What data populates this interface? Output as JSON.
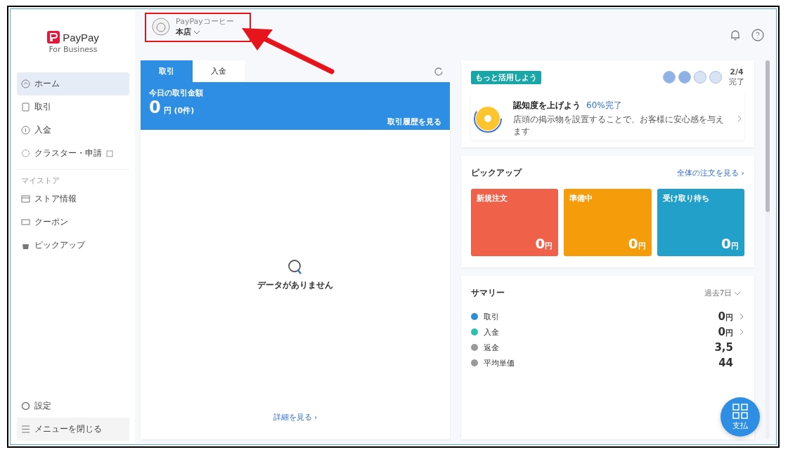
{
  "logo": {
    "name": "PayPay",
    "subtitle": "For Business"
  },
  "store": {
    "company": "PayPayコーヒー",
    "name": "本店"
  },
  "sidebar": {
    "items": [
      {
        "label": "ホーム",
        "selected": true,
        "external": false
      },
      {
        "label": "取引",
        "selected": false,
        "external": false
      },
      {
        "label": "入金",
        "selected": false,
        "external": false
      },
      {
        "label": "クラスター・申請",
        "selected": false,
        "external": true
      }
    ],
    "section": "マイストア",
    "store_items": [
      {
        "label": "ストア情報",
        "selected": false
      },
      {
        "label": "クーポン",
        "selected": false
      },
      {
        "label": "ピックアップ",
        "selected": false
      }
    ],
    "settings": "設定",
    "collapse": "メニューを閉じる"
  },
  "transactions": {
    "tabs": [
      {
        "label": "取引",
        "selected": true
      },
      {
        "label": "入金",
        "selected": false
      }
    ],
    "caption": "今日の取引金額",
    "amount": "0",
    "unit": "円 (0件)",
    "link": "取引履歴を見る",
    "empty": "データがありません",
    "more": "詳細を見る ›"
  },
  "onboarding": {
    "badge": "もっと活用しよう",
    "steps": [
      {
        "done": true
      },
      {
        "done": true
      },
      {
        "done": false
      },
      {
        "done": false
      }
    ],
    "progress": "2/4",
    "progress_label": "完了",
    "title": "認知度を上げよう",
    "percent": "60%完了",
    "description": "店頭の掲示物を設置することで、お客様に安心感を与えます"
  },
  "pickup": {
    "title": "ピックアップ",
    "link": "全体の注文を見る ›",
    "tiles": [
      {
        "label": "新規注文",
        "value": "0",
        "unit": "円",
        "color": "#f0614a"
      },
      {
        "label": "準備中",
        "value": "0",
        "unit": "円",
        "color": "#f59c0a"
      },
      {
        "label": "受け取り待ち",
        "value": "0",
        "unit": "円",
        "color": "#23a0c9"
      }
    ]
  },
  "summary": {
    "title": "サマリー",
    "period": "過去7日",
    "rows": [
      {
        "label": "取引",
        "value": "0",
        "unit": "円",
        "color": "#2b8fd6",
        "link": true
      },
      {
        "label": "入金",
        "value": "0",
        "unit": "円",
        "color": "#2bc0b0",
        "link": true
      },
      {
        "label": "返金",
        "value": "3,5",
        "unit": "",
        "color": "#9a9a9a",
        "link": false
      },
      {
        "label": "平均単価",
        "value": "44",
        "unit": "",
        "color": "#9a9a9a",
        "link": false
      }
    ]
  },
  "fab": {
    "label": "支払"
  }
}
